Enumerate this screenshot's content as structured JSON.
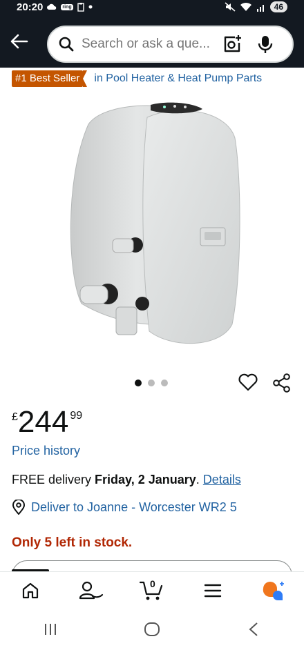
{
  "status_bar": {
    "time": "20:20",
    "ring_label": "ring",
    "battery": "46"
  },
  "header": {
    "search_placeholder": "Search or ask a que..."
  },
  "badge": {
    "label": "#1 Best Seller",
    "category": "in Pool Heater & Heat Pump Parts"
  },
  "carousel": {
    "count": 3,
    "active_index": 0
  },
  "price": {
    "currency": "£",
    "whole": "244",
    "fraction": "99"
  },
  "price_history_label": "Price history",
  "delivery": {
    "prefix": "FREE delivery",
    "date": "Friday, 2 January",
    "suffix": ".",
    "details_link": "Details"
  },
  "deliver_to": "Deliver to Joanne - Worcester WR2 5",
  "stock": "Only 5 left in stock.",
  "bottom_nav": {
    "cart_count": "0",
    "items": [
      "home-icon",
      "account-icon",
      "cart-icon",
      "menu-icon",
      "rufus-icon"
    ]
  },
  "colors": {
    "header_bg": "#131921",
    "best_seller": "#c45500",
    "link": "#2162a1",
    "stock": "#b12704",
    "rufus_orange": "#f0761d",
    "rufus_blue": "#2f7cf6"
  }
}
